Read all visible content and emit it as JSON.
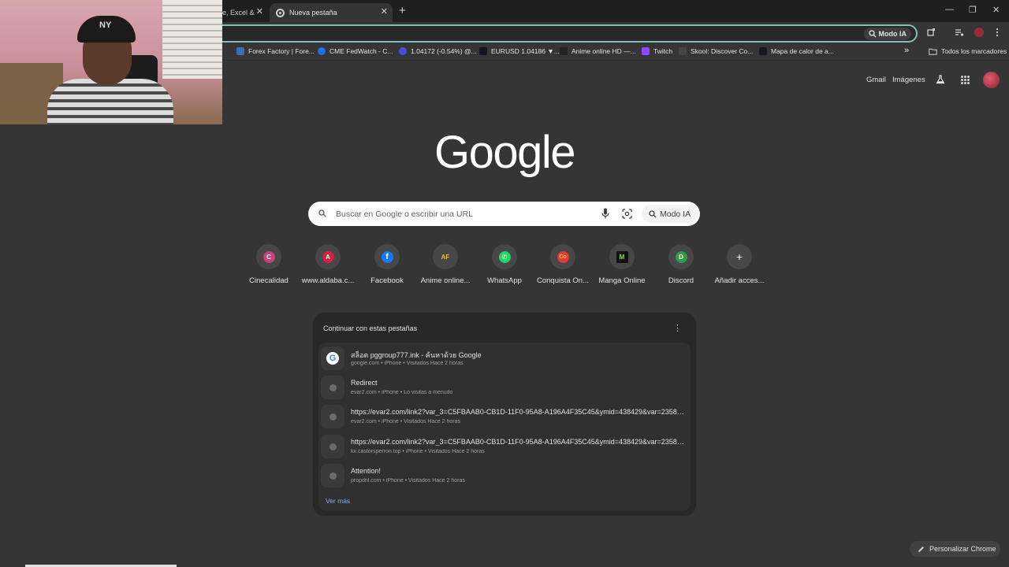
{
  "tabs": {
    "prev_title": "e, Excel &",
    "active_title": "Nueva pestaña",
    "close_glyph": "✕",
    "new_tab_glyph": "+"
  },
  "window_controls": {
    "minimize": "—",
    "restore": "❐",
    "close": "✕"
  },
  "omnibox": {
    "modo_ia_label": "Modo IA"
  },
  "bookmarks": {
    "items": [
      {
        "label": "Forex Factory | Fore...",
        "icon_color": "#3a6fb5"
      },
      {
        "label": "CME FedWatch - C...",
        "icon_color": "#1a73e8"
      },
      {
        "label": "1.04172 (-0.54%) @...",
        "icon_color": "#4a4ae0"
      },
      {
        "label": "EURUSD 1.04186 ▼...",
        "icon_color": "#131722"
      },
      {
        "label": "Anime online HD —...",
        "icon_color": "#222222"
      },
      {
        "label": "Twitch",
        "icon_color": "#9146ff"
      },
      {
        "label": "Skool: Discover Co...",
        "icon_color": "#444444"
      },
      {
        "label": "Mapa de calor de a...",
        "icon_color": "#131722"
      }
    ],
    "overflow_glyph": "»",
    "all_bookmarks_label": "Todos los marcadores"
  },
  "ntp_header": {
    "gmail": "Gmail",
    "images": "Imágenes"
  },
  "logo": "Google",
  "search": {
    "placeholder": "Buscar en Google o escribir una URL",
    "modo_ia_label": "Modo IA"
  },
  "shortcuts": [
    {
      "label": "Cinecalidad",
      "letter": "C",
      "color": "#c0457e"
    },
    {
      "label": "www.aldaba.c...",
      "letter": "A",
      "color": "#d4213d"
    },
    {
      "label": "Facebook",
      "letter": "f",
      "color": "#1877f2"
    },
    {
      "label": "Anime online...",
      "letter": "AF",
      "color": "#3a3a3a"
    },
    {
      "label": "WhatsApp",
      "letter": "✆",
      "color": "#25d366"
    },
    {
      "label": "Conquista On...",
      "letter": "Co",
      "color": "#e53935"
    },
    {
      "label": "Manga Online",
      "letter": "M",
      "color": "#111111"
    },
    {
      "label": "Discord",
      "letter": "D",
      "color": "#2e9e45"
    },
    {
      "label": "Añadir acces...",
      "letter": "+",
      "color": "#474747"
    }
  ],
  "continue_card": {
    "title": "Continuar con estas pestañas",
    "menu_glyph": "⋮",
    "rows": [
      {
        "title": "สล็อต pggroup777.ink - ค้นหาด้วย Google",
        "sub": "google.com • iPhone • Visitados Hace 2 horas",
        "icon": "google"
      },
      {
        "title": "Redirect",
        "sub": "evar2.com • iPhone • Lo visitas a menudo",
        "icon": "globe"
      },
      {
        "title": "https://evar2.com/link2?var_3=C5FBAAB0-CB1D-11F0-95A8-A196A4F35C45&ymid=438429&var=235804&z...",
        "sub": "evar2.com • iPhone • Visitados Hace 2 horas",
        "icon": "globe"
      },
      {
        "title": "https://evar2.com/link2?var_3=C5FBAAB0-CB1D-11F0-95A8-A196A4F35C45&ymid=438429&var=235804&z...",
        "sub": "kx.castorsperron.top • iPhone • Visitados Hace 2 horas",
        "icon": "globe"
      },
      {
        "title": "Attention!",
        "sub": "propdril.com • iPhone • Visitados Hace 2 horas",
        "icon": "globe"
      }
    ],
    "see_more": "Ver más"
  },
  "customize_label": "Personalizar Chrome",
  "webcam": {
    "cap_logo": "NY"
  },
  "colors": {
    "page_bg": "#353535",
    "card_bg": "#282828",
    "accent_link": "#7cacf8",
    "omnibox_focus": "#7fbfb7"
  }
}
